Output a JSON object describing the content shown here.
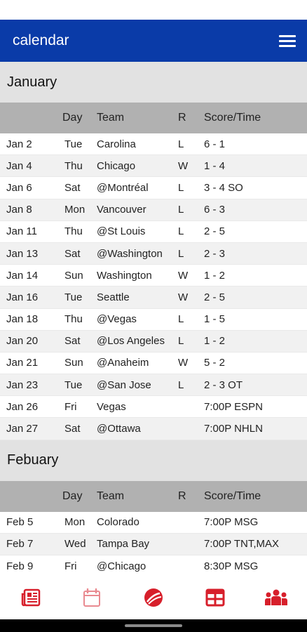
{
  "app": {
    "title": "calendar"
  },
  "columns": {
    "day": "Day",
    "team": "Team",
    "result": "R",
    "score": "Score/Time"
  },
  "months": [
    {
      "name": "January",
      "games": [
        {
          "date": "Jan 2",
          "day": "Tue",
          "team": "Carolina",
          "result": "L",
          "score": "6 - 1"
        },
        {
          "date": "Jan 4",
          "day": "Thu",
          "team": "Chicago",
          "result": "W",
          "score": "1 - 4"
        },
        {
          "date": "Jan 6",
          "day": "Sat",
          "team": "@Montréal",
          "result": "L",
          "score": "3 - 4 SO"
        },
        {
          "date": "Jan 8",
          "day": "Mon",
          "team": "Vancouver",
          "result": "L",
          "score": "6 - 3"
        },
        {
          "date": "Jan 11",
          "day": "Thu",
          "team": "@St Louis",
          "result": "L",
          "score": "2 - 5"
        },
        {
          "date": "Jan 13",
          "day": "Sat",
          "team": "@Washington",
          "result": "L",
          "score": "2 - 3"
        },
        {
          "date": "Jan 14",
          "day": "Sun",
          "team": "Washington",
          "result": "W",
          "score": "1 - 2"
        },
        {
          "date": "Jan 16",
          "day": "Tue",
          "team": "Seattle",
          "result": "W",
          "score": "2 - 5"
        },
        {
          "date": "Jan 18",
          "day": "Thu",
          "team": "@Vegas",
          "result": "L",
          "score": "1 - 5"
        },
        {
          "date": "Jan 20",
          "day": "Sat",
          "team": "@Los Angeles",
          "result": "L",
          "score": "1 - 2"
        },
        {
          "date": "Jan 21",
          "day": "Sun",
          "team": "@Anaheim",
          "result": "W",
          "score": "5 - 2"
        },
        {
          "date": "Jan 23",
          "day": "Tue",
          "team": "@San Jose",
          "result": "L",
          "score": "2 - 3 OT"
        },
        {
          "date": "Jan 26",
          "day": "Fri",
          "team": "Vegas",
          "result": "",
          "score": "7:00P ESPN"
        },
        {
          "date": "Jan 27",
          "day": "Sat",
          "team": "@Ottawa",
          "result": "",
          "score": "7:00P NHLN"
        }
      ]
    },
    {
      "name": "Febuary",
      "games": [
        {
          "date": "Feb 5",
          "day": "Mon",
          "team": "Colorado",
          "result": "",
          "score": "7:00P MSG"
        },
        {
          "date": "Feb 7",
          "day": "Wed",
          "team": "Tampa Bay",
          "result": "",
          "score": "7:00P TNT,MAX"
        },
        {
          "date": "Feb 9",
          "day": "Fri",
          "team": "@Chicago",
          "result": "",
          "score": "8:30P MSG"
        }
      ]
    }
  ],
  "bottom_nav": [
    {
      "icon": "newspaper-icon",
      "active": false
    },
    {
      "icon": "calendar-icon",
      "active": true
    },
    {
      "icon": "hockey-puck-icon",
      "active": false
    },
    {
      "icon": "standings-table-icon",
      "active": false
    },
    {
      "icon": "team-roster-icon",
      "active": false
    }
  ],
  "colors": {
    "app_bar": "#0a3ba8",
    "accent": "#d71f2b",
    "accent_light": "#e98a90"
  }
}
